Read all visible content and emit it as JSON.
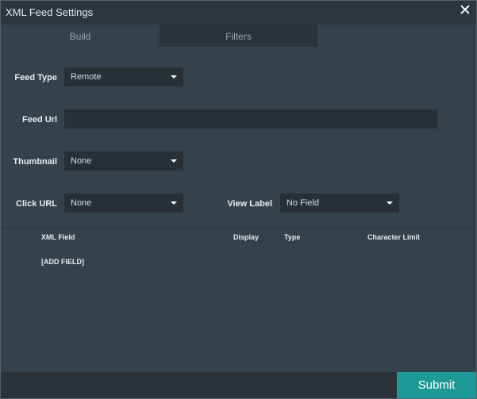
{
  "window": {
    "title": "XML Feed Settings",
    "close_symbol": "✕",
    "close_icon": "close-icon"
  },
  "tabs": [
    {
      "label": "Build",
      "active": true
    },
    {
      "label": "Filters",
      "active": false
    }
  ],
  "form": {
    "feed_type": {
      "label": "Feed Type",
      "value": "Remote"
    },
    "feed_url": {
      "label": "Feed Url",
      "value": "",
      "placeholder": ""
    },
    "thumbnail": {
      "label": "Thumbnail",
      "value": "None"
    },
    "click_url": {
      "label": "Click URL",
      "value": "None"
    },
    "view_label": {
      "label": "View Label",
      "value": "No Field"
    }
  },
  "fields_table": {
    "columns": [
      "XML Field",
      "Display",
      "Type",
      "Character Limit"
    ],
    "add_field_label": "[ADD FIELD]"
  },
  "footer": {
    "submit_label": "Submit"
  },
  "colors": {
    "accent": "#1e9a96",
    "background": "#36424b",
    "input_background": "#283036"
  }
}
